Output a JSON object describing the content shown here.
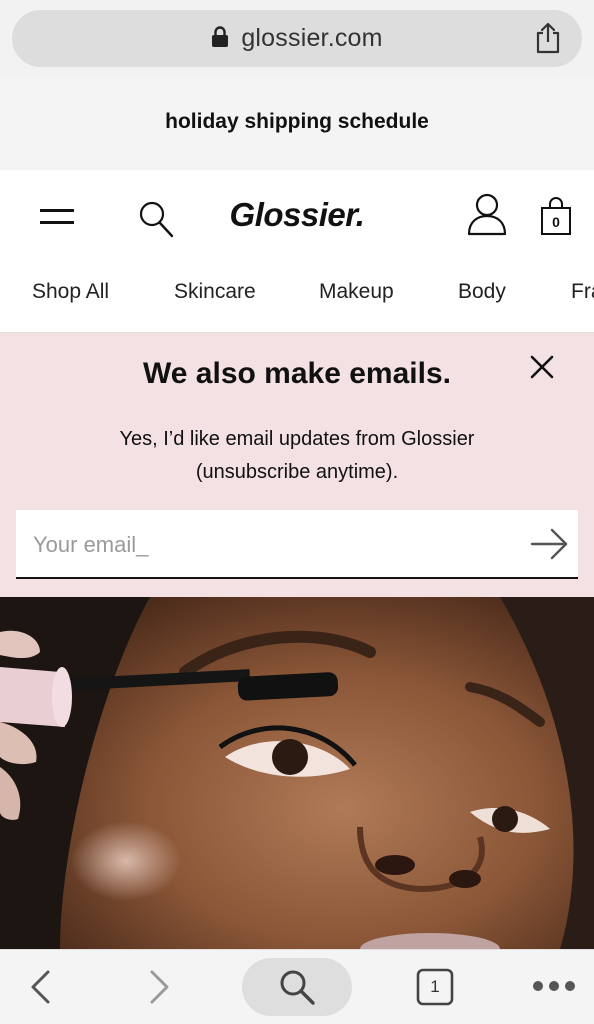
{
  "browser": {
    "url": "glossier.com",
    "lock_icon": "lock-icon",
    "share_icon": "share-icon"
  },
  "announcement": {
    "text": "holiday shipping schedule"
  },
  "header": {
    "logo": "Glossier.",
    "menu_icon": "hamburger-menu-icon",
    "search_icon": "search-icon",
    "account_icon": "account-icon",
    "bag_icon": "shopping-bag-icon",
    "bag_count": "0"
  },
  "nav": {
    "items": [
      "Shop All",
      "Skincare",
      "Makeup",
      "Body",
      "Fra"
    ]
  },
  "signup": {
    "title": "We also make emails.",
    "description_line1": "Yes, I’d like email updates from Glossier",
    "description_line2": "(unsubscribe anytime).",
    "placeholder": "Your email_",
    "close_icon": "close-icon",
    "submit_icon": "arrow-right-icon"
  },
  "toolbar": {
    "back_icon": "chevron-left-icon",
    "forward_icon": "chevron-right-icon",
    "search_icon": "search-icon",
    "tabs_count": "1",
    "more_icon": "more-dots-icon"
  },
  "colors": {
    "signup_bg": "#f3e1e4",
    "announcement_bg": "#f4f4f5",
    "url_pill": "#dddddd",
    "text": "#111111"
  }
}
